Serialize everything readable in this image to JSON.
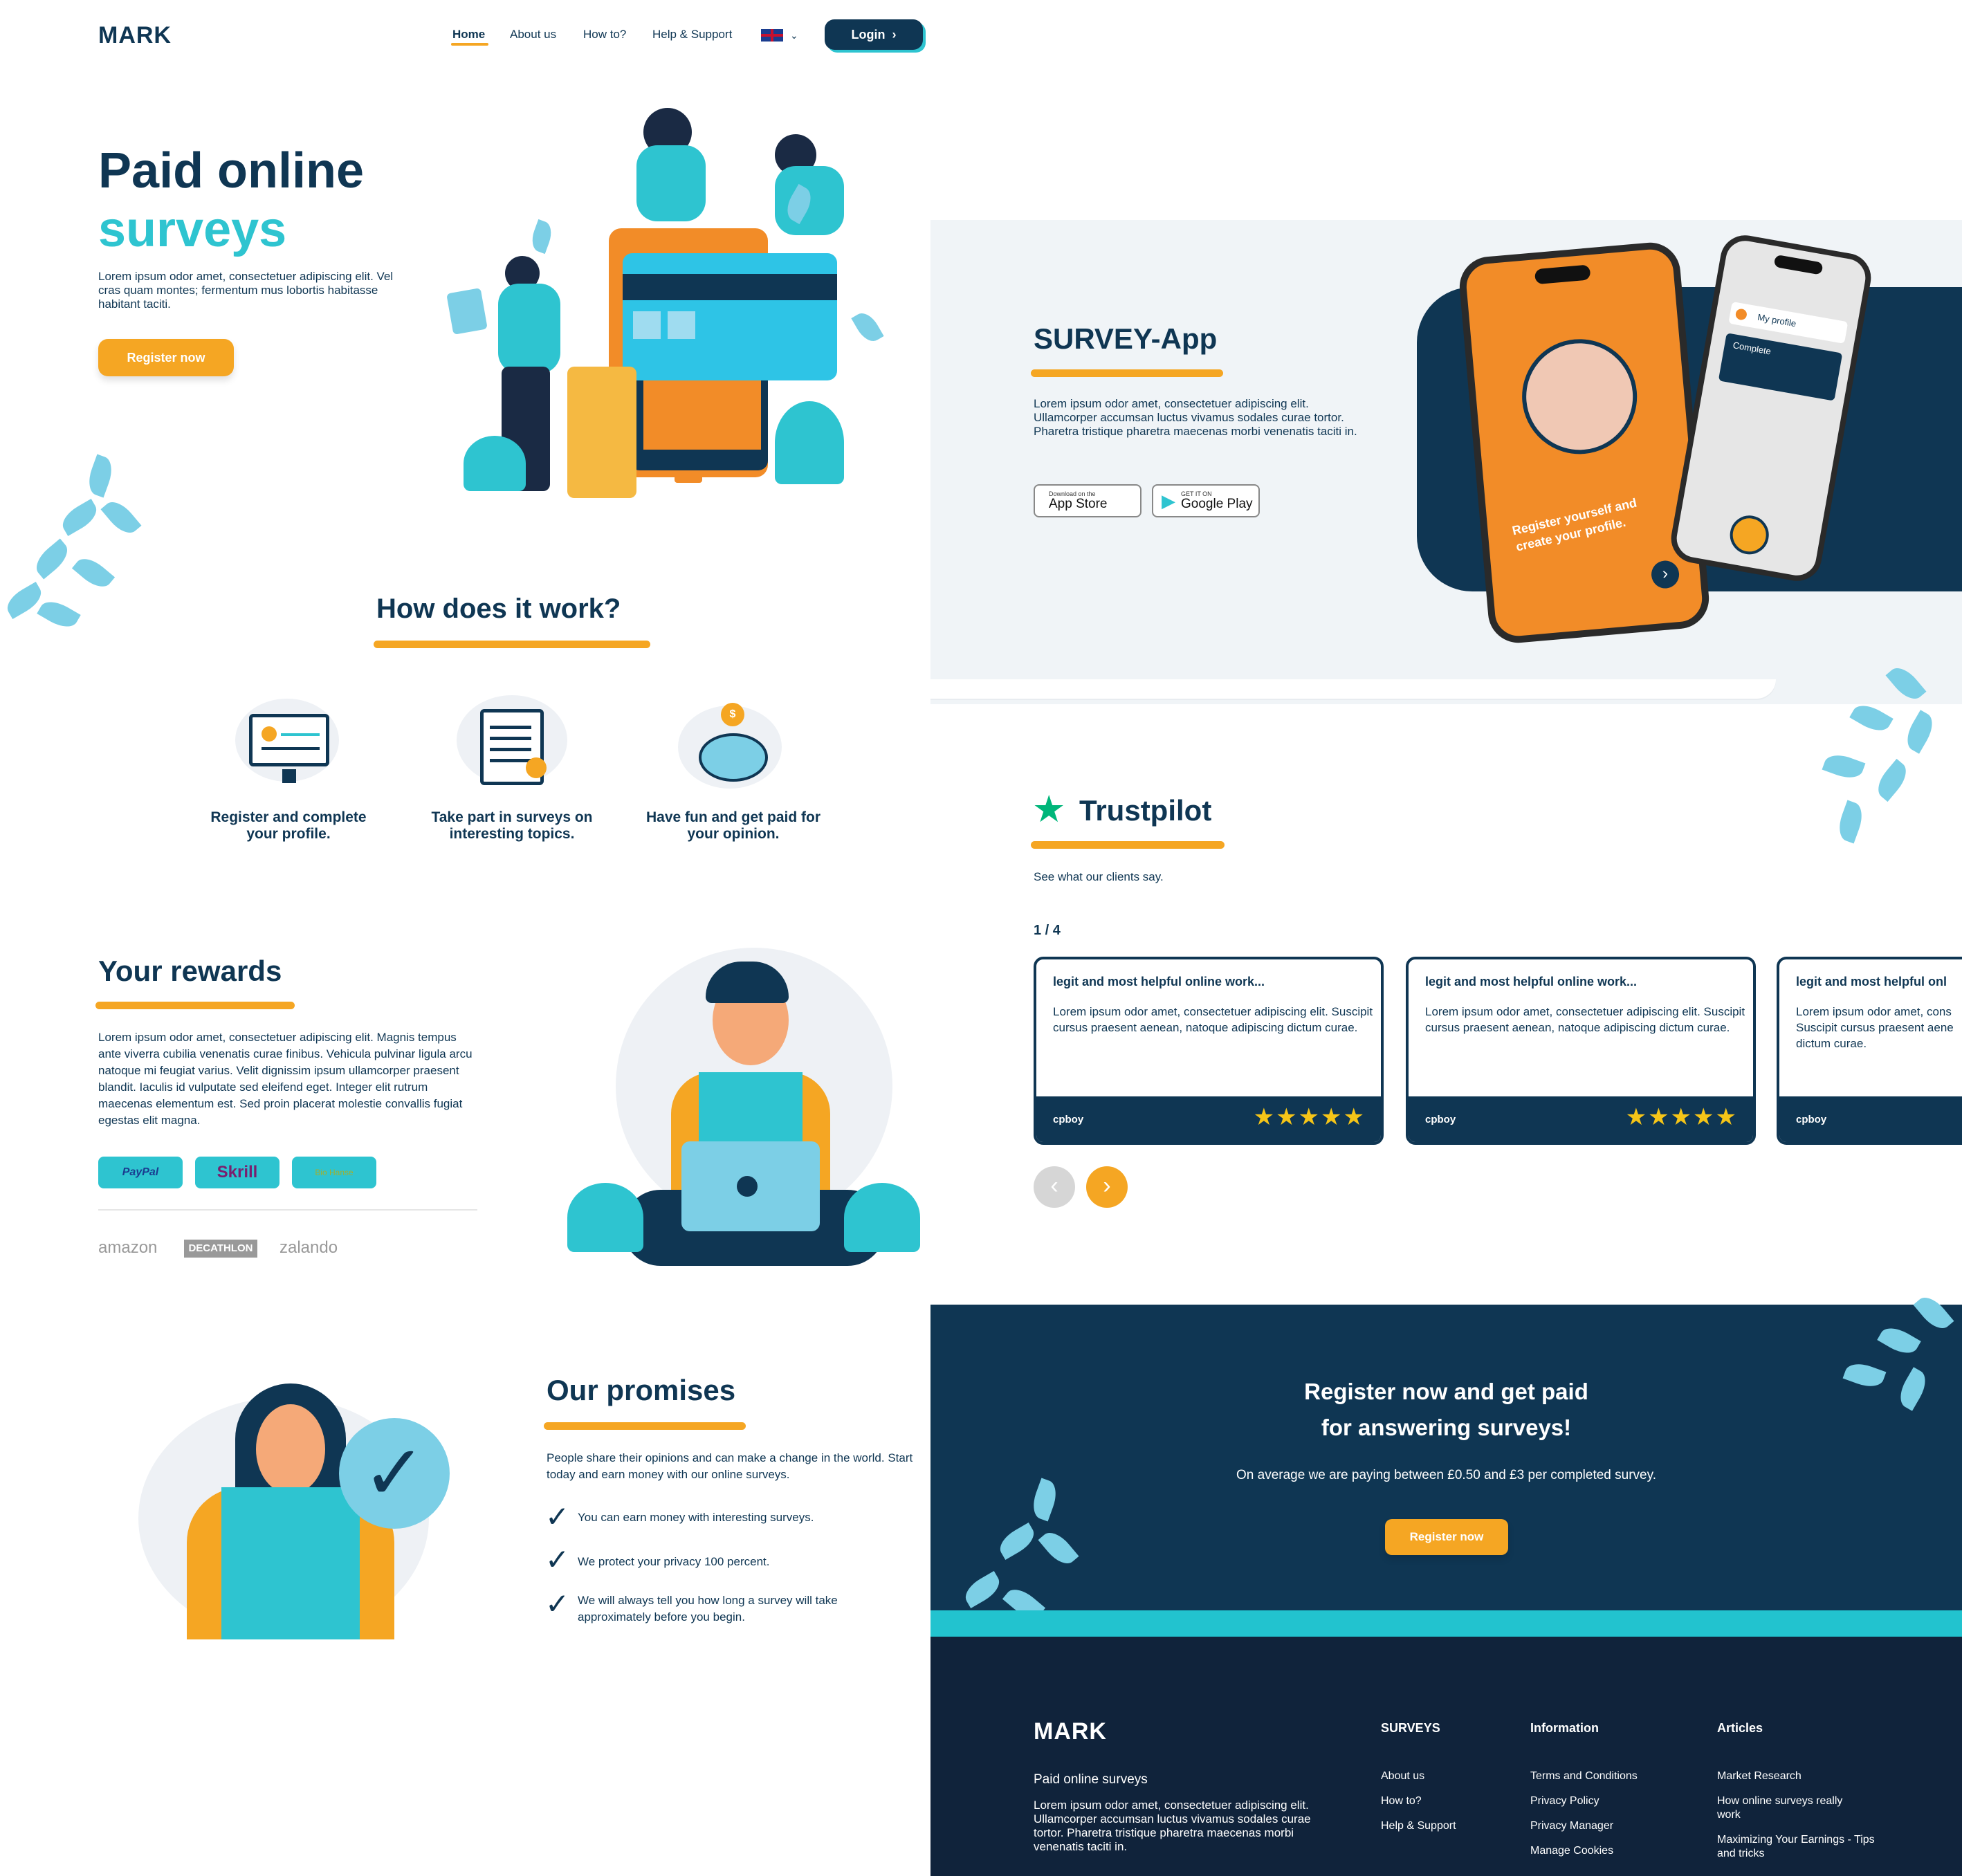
{
  "header": {
    "logo": "MARK",
    "nav": [
      "Home",
      "About us",
      "How to?",
      "Help & Support"
    ],
    "login": "Login"
  },
  "hero": {
    "title_line1": "Paid online",
    "title_line2": "surveys",
    "text": "Lorem ipsum odor amet, consectetuer adipiscing elit. Vel cras quam montes; fermentum mus lobortis habitasse habitant taciti.",
    "button": "Register now"
  },
  "how": {
    "title": "How does it work?",
    "steps": [
      "Register and complete your profile.",
      "Take part in surveys on interesting topics.",
      "Have fun and get paid for your opinion."
    ]
  },
  "rewards": {
    "title": "Your rewards",
    "text": "Lorem ipsum odor amet, consectetuer adipiscing elit. Magnis tempus ante viverra cubilia venenatis curae finibus. Vehicula pulvinar ligula arcu natoque mi feugiat varius. Velit dignissim ipsum ullamcorper praesent blandit. Iaculis id vulputate sed eleifend eget. Integer elit rutrum maecenas elementum est. Sed proin placerat molestie convallis fugiat egestas elit magna.",
    "payments": [
      "PayPal",
      "Skrill",
      "Bio Hanse"
    ],
    "brands": [
      "amazon",
      "DECATHLON",
      "zalando"
    ]
  },
  "promises": {
    "title": "Our promises",
    "text": "People share their opinions and can make a change in the world. Start today and earn money with our online surveys.",
    "items": [
      "You can earn money with interesting surveys.",
      "We protect your privacy 100 percent.",
      "We will always tell you how long a survey will take approximately before you begin."
    ]
  },
  "app": {
    "title": "SURVEY-App",
    "text": "Lorem ipsum odor amet, consectetuer adipiscing elit. Ullamcorper accumsan luctus vivamus sodales curae tortor. Pharetra tristique pharetra maecenas morbi venenatis taciti in.",
    "appstore_small": "Download on the",
    "appstore": "App Store",
    "gplay_small": "GET IT ON",
    "gplay": "Google Play",
    "phone_text": "Register yourself and create your profile.",
    "phone2_profile": "My profile",
    "phone2_complete": "Complete"
  },
  "trust": {
    "title": "Trustpilot",
    "sub": "See what our clients say.",
    "counter": "1 / 4",
    "reviews": [
      {
        "title": "legit and most helpful online work...",
        "text": "Lorem ipsum odor amet, consectetuer adipiscing elit. Suscipit cursus praesent aenean, natoque adipiscing dictum curae.",
        "user": "cpboy",
        "stars": "★★★★★"
      },
      {
        "title": "legit and most helpful online work...",
        "text": "Lorem ipsum odor amet, consectetuer adipiscing elit. Suscipit cursus praesent aenean, natoque adipiscing dictum curae.",
        "user": "cpboy",
        "stars": "★★★★★"
      },
      {
        "title": "legit and most helpful onl",
        "text": "Lorem ipsum odor amet, cons Suscipit cursus praesent aene dictum curae.",
        "user": "cpboy",
        "stars": ""
      }
    ]
  },
  "cta": {
    "line1": "Register now and get paid",
    "line2": "for answering surveys!",
    "text": "On average we are paying between £0.50 and £3 per completed survey.",
    "button": "Register now"
  },
  "footer": {
    "logo": "MARK",
    "tagline": "Paid online surveys",
    "text": "Lorem ipsum odor amet, consectetuer adipiscing elit. Ullamcorper accumsan luctus vivamus sodales curae tortor. Pharetra tristique pharetra maecenas morbi venenatis taciti in.",
    "col1_title": "SURVEYS",
    "col1": [
      "About us",
      "How to?",
      "Help & Support"
    ],
    "col2_title": "Information",
    "col2": [
      "Terms and Conditions",
      "Privacy Policy",
      "Privacy Manager",
      "Manage Cookies"
    ],
    "col3_title": "Articles",
    "col3": [
      "Market Research",
      "How online surveys really work",
      "Maximizing Your Earnings - Tips and tricks"
    ]
  },
  "colors": {
    "navy": "#0f3653",
    "orange": "#f5a623",
    "teal": "#2ec4d0",
    "light": "#f0f4f7"
  },
  "icons": [
    "chevron-right-icon",
    "chevron-down-icon",
    "uk-flag-icon",
    "apple-icon",
    "google-play-icon",
    "star-icon",
    "checkmark-icon",
    "monitor-icon",
    "clipboard-icon",
    "piggy-bank-icon"
  ]
}
